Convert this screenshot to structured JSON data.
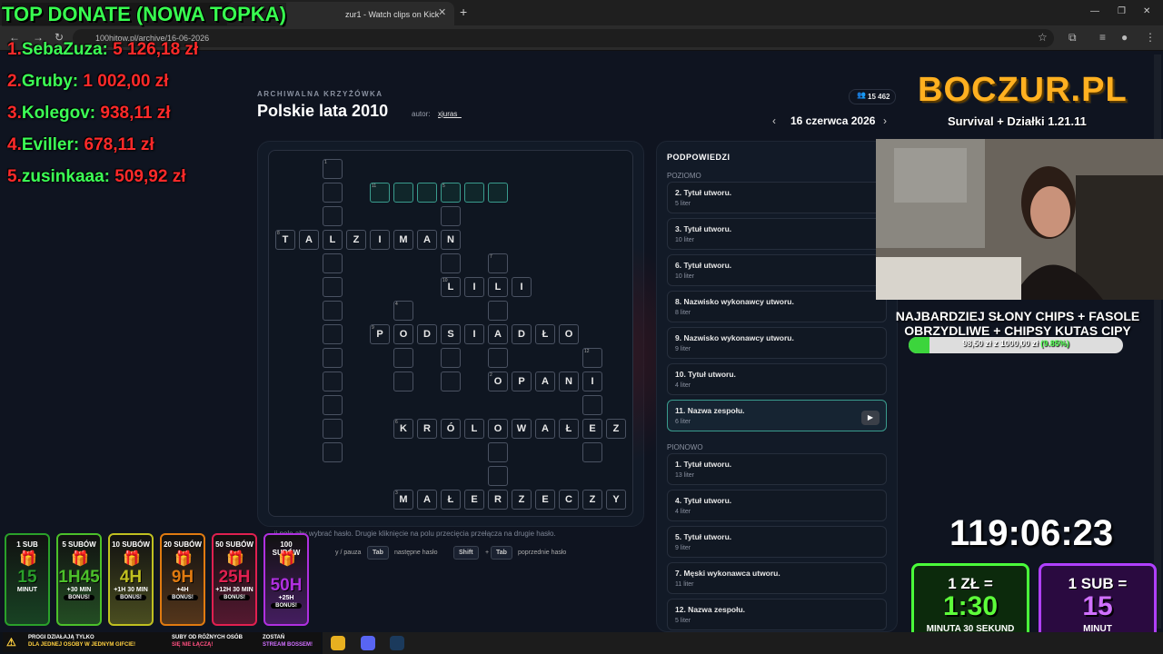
{
  "browser": {
    "tab_title": "zur1 - Watch clips on Kick",
    "url": "100hitow.pl/archive/16-06-2026"
  },
  "page": {
    "label": "ARCHIWALNA KRZYŻÓWKA",
    "title": "Polskie lata 2010",
    "author_label": "autor:",
    "author": "xjuras_",
    "views": "15 462",
    "date": "16 czerwca 2026",
    "help_text": "...ij pole aby wybrać hasło. Drugie kliknięcie na polu przecięcia przełącza na drugie hasło.",
    "shortcuts": [
      {
        "key": "...",
        "desc": "y / pauza"
      },
      {
        "key": "Tab",
        "desc": "następne hasło"
      },
      {
        "key": "Shift",
        "key2": "Tab",
        "desc": "poprzednie hasło"
      }
    ]
  },
  "crossword": {
    "words": [
      {
        "num": "8",
        "letters": [
          "T",
          "A",
          "L",
          "Z",
          "I",
          "M",
          "A",
          "N"
        ]
      },
      {
        "num": "10",
        "letters": [
          "L",
          "I",
          "L",
          "I"
        ]
      },
      {
        "num": "9",
        "letters": [
          "P",
          "O",
          "D",
          "S",
          "I",
          "A",
          "D",
          "Ł",
          "O"
        ]
      },
      {
        "num": "2",
        "letters": [
          "O",
          "P",
          "A",
          "N",
          "I"
        ]
      },
      {
        "num": "6",
        "letters": [
          "K",
          "R",
          "Ó",
          "L",
          "O",
          "W",
          "A",
          "Ł",
          "E",
          "Z"
        ]
      },
      {
        "num": "3",
        "letters": [
          "M",
          "A",
          "Ł",
          "E",
          "R",
          "Z",
          "E",
          "C",
          "Z",
          "Y"
        ]
      }
    ],
    "numbers": [
      "1",
      "11",
      "5",
      "7",
      "4",
      "12"
    ]
  },
  "hints": {
    "title": "PODPOWIEDZI",
    "across_label": "POZIOMO",
    "down_label": "PIONOWO",
    "across": [
      {
        "title": "2. Tytuł utworu.",
        "sub": "5 liter"
      },
      {
        "title": "3. Tytuł utworu.",
        "sub": "10 liter"
      },
      {
        "title": "6. Tytuł utworu.",
        "sub": "10 liter"
      },
      {
        "title": "8. Nazwisko wykonawcy utworu.",
        "sub": "8 liter"
      },
      {
        "title": "9. Nazwisko wykonawcy utworu.",
        "sub": "9 liter"
      },
      {
        "title": "10. Tytuł utworu.",
        "sub": "4 liter"
      },
      {
        "title": "11. Nazwa zespołu.",
        "sub": "6 liter"
      }
    ],
    "down": [
      {
        "title": "1. Tytuł utworu.",
        "sub": "13 liter"
      },
      {
        "title": "4. Tytuł utworu.",
        "sub": "4 liter"
      },
      {
        "title": "5. Tytuł utworu.",
        "sub": "9 liter"
      },
      {
        "title": "7. Męski wykonawca utworu.",
        "sub": "11 liter"
      },
      {
        "title": "12. Nazwa zespołu.",
        "sub": "5 liter"
      }
    ]
  },
  "overlay": {
    "donate_title": "TOP DONATE (NOWA TOPKA)",
    "donors": [
      {
        "rank": "1.",
        "name": "SebaZuza:",
        "amount": "5 126,18 zł"
      },
      {
        "rank": "2.",
        "name": "Gruby:",
        "amount": "1 002,00 zł"
      },
      {
        "rank": "3.",
        "name": "Kolegov:",
        "amount": "938,11 zł"
      },
      {
        "rank": "4.",
        "name": "Eviller:",
        "amount": "678,11 zł"
      },
      {
        "rank": "5.",
        "name": "zusinkaaa:",
        "amount": "509,92 zł"
      }
    ],
    "logo_title": "BOCZUR.PL",
    "logo_sub": "Survival + Działki 1.21.11",
    "goal_line1": "NAJBARDZIEJ SŁONY CHIPS + FASOLE",
    "goal_line2": "OBRZYDLIWE + CHIPSY KUTAS CIPY",
    "goal_amount": "98,50 zł z 1000,00 zł",
    "goal_percent": "(9.85%)",
    "goal_fraction": 0.0985,
    "timer": "119:06:23",
    "zl_box": {
      "top": "1 ZŁ =",
      "big": "1:30",
      "bottom": "MINUTA 30 SEKUND"
    },
    "sub_box": {
      "top": "1 SUB =",
      "big": "15",
      "bottom": "MINUT"
    },
    "tiers": [
      {
        "label": "1 SUB",
        "big": "15",
        "sub": "MINUT",
        "bonus": "",
        "color": "#2aa02a"
      },
      {
        "label": "5 SUBÓW",
        "big": "1H45",
        "sub": "+30 MIN",
        "bonus": "BONUS!",
        "color": "#4cc02a"
      },
      {
        "label": "10 SUBÓW",
        "big": "4H",
        "sub": "+1H 30 MIN",
        "bonus": "BONUS!",
        "color": "#c0c020"
      },
      {
        "label": "20 SUBÓW",
        "big": "9H",
        "sub": "+4H",
        "bonus": "BONUS!",
        "color": "#e07a10"
      },
      {
        "label": "50 SUBÓW",
        "big": "25H",
        "sub": "+12H 30 MIN",
        "bonus": "BONUS!",
        "color": "#e02050"
      },
      {
        "label": "100 SUBÓW",
        "big": "50H",
        "sub": "+25H",
        "bonus": "BONUS!",
        "color": "#b030e0"
      }
    ],
    "promo": [
      "PROGI DZIAŁAJĄ TYLKO",
      "DLA JEDNEJ OSOBY W JEDNYM GIFCIE!",
      "SUBY OD RÓŻNYCH OSÓB",
      "SIĘ NIE ŁĄCZĄ!",
      "ZOSTAŃ",
      "STREAM BOSSEM!"
    ]
  },
  "colors": {
    "accent": "#3a9c8e",
    "donate_green": "#38ff50",
    "donate_red": "#ff2a2a"
  }
}
